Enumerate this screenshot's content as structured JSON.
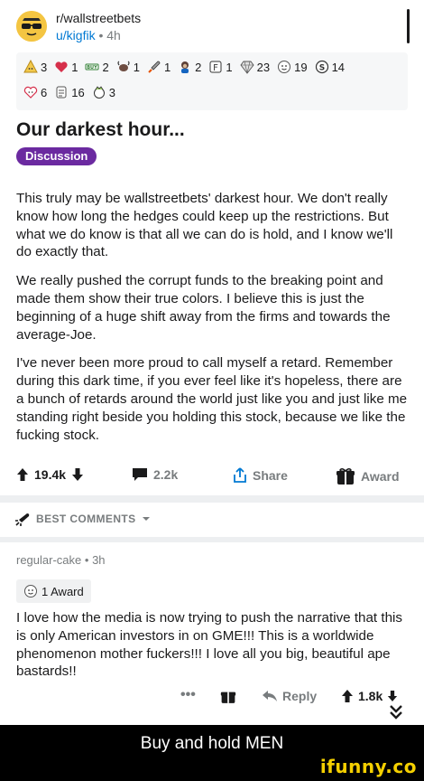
{
  "post": {
    "subreddit": "r/wallstreetbets",
    "author": "u/kigfik",
    "separator": "•",
    "age": "4h",
    "title": "Our darkest hour...",
    "flair": "Discussion",
    "flair_color": "#6b2aa0",
    "paragraphs": [
      "This truly may be wallstreetbets' darkest hour. We don't really know how long the hedges could keep up the restrictions. But what we do know is that all we can do is hold, and I know we'll do exactly that.",
      "We really pushed the corrupt funds to the breaking point and made them show their true colors. I believe this is just the beginning of a huge shift away from the firms and towards the average-Joe.",
      "I've never been more proud to call myself a retard. Remember during this dark time, if you ever feel like it's hopeless, there are a bunch of retards around the world just like you and just like me standing right beside you holding this stock, because we like the fucking stock."
    ],
    "awards_row1": [
      {
        "icon": "wholesome-award-icon",
        "count": "3"
      },
      {
        "icon": "heart-award-icon",
        "count": "1"
      },
      {
        "icon": "buy-award-icon",
        "count": "2"
      },
      {
        "icon": "bull-award-icon",
        "count": "1"
      },
      {
        "icon": "rocket-award-icon",
        "count": "1"
      },
      {
        "icon": "ape-award-icon",
        "count": "2"
      },
      {
        "icon": "f-award-icon",
        "count": "1"
      },
      {
        "icon": "diamond-hands-award-icon",
        "count": "23"
      },
      {
        "icon": "silver-award-icon",
        "count": "19"
      },
      {
        "icon": "money-award-icon",
        "count": "14"
      }
    ],
    "awards_row2": [
      {
        "icon": "wholesome-heart-award-icon",
        "count": "6"
      },
      {
        "icon": "ape-hand-award-icon",
        "count": "16"
      },
      {
        "icon": "helpful-award-icon",
        "count": "3"
      }
    ],
    "actions": {
      "votes": "19.4k",
      "comments": "2.2k",
      "share": "Share",
      "award": "Award"
    }
  },
  "sort": {
    "label": "BEST COMMENTS"
  },
  "comment": {
    "author": "regular-cake",
    "separator": "•",
    "age": "3h",
    "award_label": "1 Award",
    "text": "I love how the media is now trying to push the narrative that this is only American investors in on GME!!! This is a worldwide phenomenon mother fuckers!!! I love all you big, beautiful ape bastards!!",
    "more": "•••",
    "reply": "Reply",
    "votes": "1.8k"
  },
  "caption": {
    "text": "Buy and hold MEN",
    "watermark": "ifunny.co"
  },
  "colors": {
    "link_blue": "#0079d3",
    "meta_gray": "#787c7e",
    "text": "#1a1a1b",
    "watermark_yellow": "#f5d000"
  }
}
